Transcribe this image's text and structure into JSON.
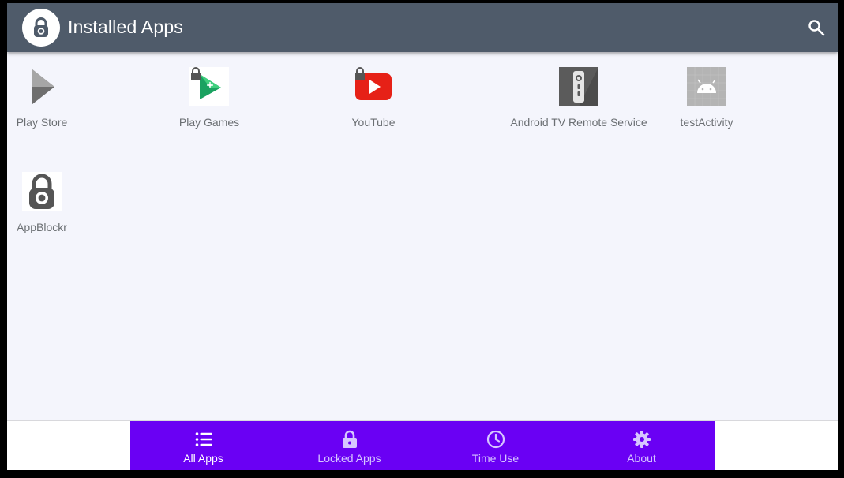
{
  "header": {
    "title": "Installed Apps",
    "logo_icon": "padlock-icon",
    "search_icon": "search-icon",
    "background_color": "#4f5b6a"
  },
  "apps": [
    {
      "label": "Play Store",
      "icon": "play-store-icon",
      "locked": false
    },
    {
      "label": "Play Games",
      "icon": "play-games-icon",
      "locked": true
    },
    {
      "label": "YouTube",
      "icon": "youtube-icon",
      "locked": true
    },
    {
      "label": "Android TV Remote Service",
      "icon": "tv-remote-icon",
      "locked": false
    },
    {
      "label": "testActivity",
      "icon": "android-icon",
      "locked": false
    },
    {
      "label": "AppBlockr",
      "icon": "appblockr-lock-icon",
      "locked": false
    }
  ],
  "bottom_nav": {
    "background_color": "#6a00f4",
    "active_index": 0,
    "items": [
      {
        "label": "All Apps",
        "icon": "list-icon"
      },
      {
        "label": "Locked Apps",
        "icon": "lock-icon"
      },
      {
        "label": "Time Use",
        "icon": "clock-icon"
      },
      {
        "label": "About",
        "icon": "gear-icon"
      }
    ]
  }
}
